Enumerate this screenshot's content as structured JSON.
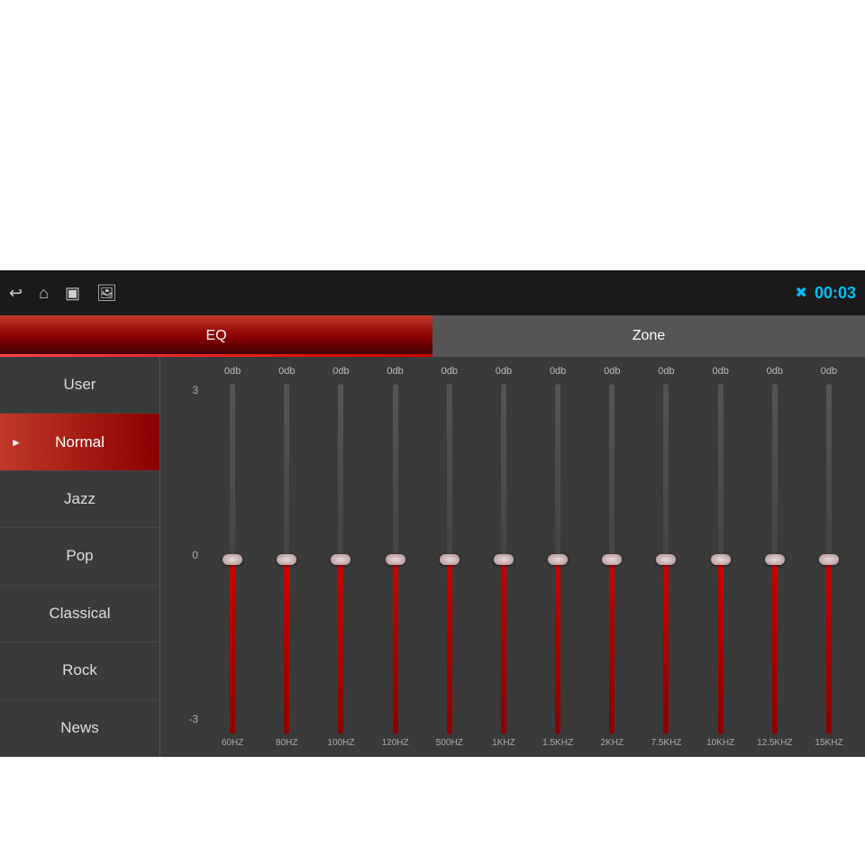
{
  "screen": {
    "topBar": {
      "icons": [
        "back-arrow",
        "home",
        "window",
        "image"
      ],
      "bluetooth": "bluetooth",
      "time": "00:03"
    },
    "tabs": [
      {
        "label": "EQ",
        "active": true
      },
      {
        "label": "Zone",
        "active": false
      }
    ],
    "sidebar": {
      "items": [
        {
          "label": "User",
          "active": false
        },
        {
          "label": "Normal",
          "active": true
        },
        {
          "label": "Jazz",
          "active": false
        },
        {
          "label": "Pop",
          "active": false
        },
        {
          "label": "Classical",
          "active": false
        },
        {
          "label": "Rock",
          "active": false
        },
        {
          "label": "News",
          "active": false
        }
      ]
    },
    "eq": {
      "yAxis": [
        "3",
        "0",
        "-3"
      ],
      "sliders": [
        {
          "freq": "60HZ",
          "db": "0db",
          "value": 0
        },
        {
          "freq": "80HZ",
          "db": "0db",
          "value": 0
        },
        {
          "freq": "100HZ",
          "db": "0db",
          "value": 0
        },
        {
          "freq": "120HZ",
          "db": "0db",
          "value": 0
        },
        {
          "freq": "500HZ",
          "db": "0db",
          "value": 0
        },
        {
          "freq": "1KHZ",
          "db": "0db",
          "value": 0
        },
        {
          "freq": "1.5KHZ",
          "db": "0db",
          "value": 0
        },
        {
          "freq": "2KHZ",
          "db": "0db",
          "value": 0
        },
        {
          "freq": "7.5KHZ",
          "db": "0db",
          "value": 0
        },
        {
          "freq": "10KHZ",
          "db": "0db",
          "value": 0
        },
        {
          "freq": "12.5KHZ",
          "db": "0db",
          "value": 0
        },
        {
          "freq": "15KHZ",
          "db": "0db",
          "value": 0
        }
      ]
    }
  }
}
